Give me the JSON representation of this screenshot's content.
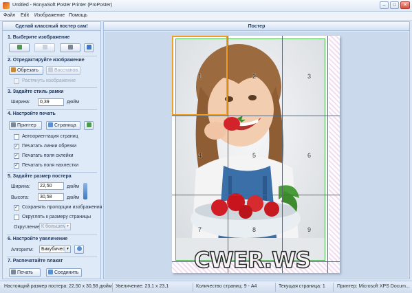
{
  "window": {
    "title": "Untitled - RonyaSoft Poster Printer (ProPoster)"
  },
  "menu": [
    "Файл",
    "Edit",
    "Изображение",
    "Помощь"
  ],
  "left": {
    "header": "Сделай классный постер сам!",
    "s1": {
      "title": "1. Выберите изображение"
    },
    "s2": {
      "title": "2. Отредактируйте изображение",
      "crop": "Обрезать",
      "restore": "Восстанов.",
      "stretch": "Растянуть изображение"
    },
    "s3": {
      "title": "3. Задайте стиль рамки",
      "width_label": "Ширина:",
      "width_value": "0,39",
      "unit": "дюйм"
    },
    "s4": {
      "title": "4. Настройте печать",
      "printer": "Принтер",
      "page": "Страница",
      "auto_orient": "Автоориентация страниц",
      "cut_lines": "Печатать линии обрезки",
      "glue_fields": "Печатать поля склейки",
      "overlap_fields": "Печатать поля нахлестки"
    },
    "s5": {
      "title": "5. Задайте размер постера",
      "width_label": "Ширина:",
      "width_value": "22,50",
      "height_label": "Высота:",
      "height_value": "30,58",
      "unit": "дюйм",
      "keep_ratio": "Сохранять пропорции изображения",
      "round_page": "Округлять к размеру страницы",
      "rounding_label": "Округление:",
      "rounding_value": "К большем"
    },
    "s6": {
      "title": "6. Настройте увеличение",
      "algo_label": "Алгоритм:",
      "algo_value": "Бикубичес"
    },
    "s7": {
      "title": "7. Распечатайте плакат",
      "print": "Печать",
      "join": "Соединить"
    }
  },
  "right": {
    "header": "Постер",
    "tiles": [
      "1",
      "2",
      "3",
      "4",
      "5",
      "6",
      "7",
      "8",
      "9"
    ],
    "watermark": "CWER.WS"
  },
  "status": {
    "size": "Настоящий размер постера: 22,50 x 30,58 дюйм",
    "zoom": "Увеличение: 23,1 x 23,1",
    "pages": "Количество страниц: 9 - A4",
    "current": "Текущая страница: 1",
    "printer": "Принтер: Microsoft XPS Docum..."
  },
  "colors": {
    "accent": "#3f78c6",
    "selected_tile": "#f0a020",
    "frame_green": "#4cb34c"
  }
}
